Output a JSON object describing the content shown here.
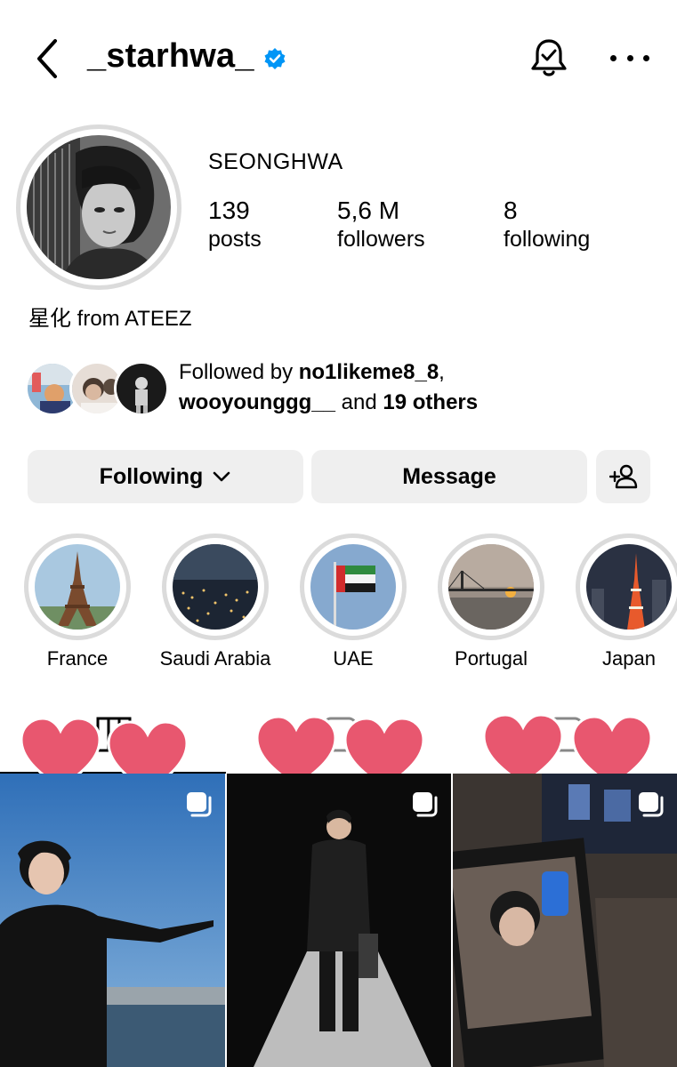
{
  "header": {
    "username": "_starhwa_",
    "verified": true,
    "icons": [
      "back-chevron-icon",
      "verified-badge-icon",
      "notification-bell-icon",
      "more-options-icon"
    ]
  },
  "profile": {
    "display_name": "SEONGHWA",
    "stats": [
      {
        "value": "139",
        "label": "posts"
      },
      {
        "value": "5,6 M",
        "label": "followers"
      },
      {
        "value": "8",
        "label": "following"
      }
    ],
    "bio": "星化 from ATEEZ"
  },
  "followed_by": {
    "prefix": "Followed by ",
    "user1": "no1likeme8_8",
    "comma": ",",
    "user2": "wooyounggg__",
    "middle": " and ",
    "others": "19 others"
  },
  "actions": {
    "following_label": "Following",
    "message_label": "Message"
  },
  "highlights": [
    {
      "label": "France"
    },
    {
      "label": "Saudi Arabia"
    },
    {
      "label": "UAE"
    },
    {
      "label": "Portugal"
    },
    {
      "label": "Japan"
    }
  ],
  "colors": {
    "verified": "#0095f6",
    "button_bg": "#efefef",
    "ring": "#dbdbdb",
    "heart": "#e8576f"
  }
}
